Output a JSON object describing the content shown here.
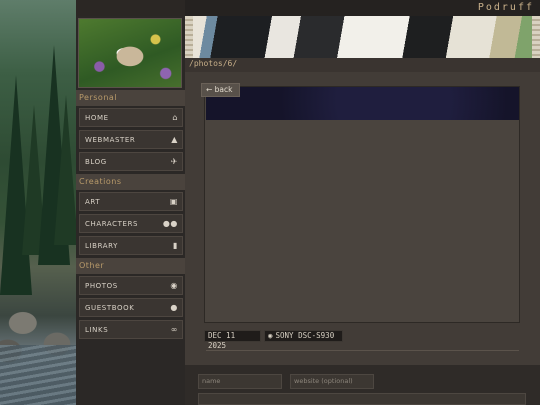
{
  "site": {
    "title": "Podruff"
  },
  "breadcrumb": {
    "path": "/photos/6/"
  },
  "sidebar": {
    "sections": [
      {
        "label": "Personal",
        "items": [
          {
            "label": "HOME",
            "icon": "home-icon"
          },
          {
            "label": "WEBMASTER",
            "icon": "bell-icon"
          },
          {
            "label": "BLOG",
            "icon": "plane-icon"
          }
        ]
      },
      {
        "label": "Creations",
        "items": [
          {
            "label": "ART",
            "icon": "image-icon"
          },
          {
            "label": "CHARACTERS",
            "icon": "users-icon"
          },
          {
            "label": "LIBRARY",
            "icon": "book-icon"
          }
        ]
      },
      {
        "label": "Other",
        "items": [
          {
            "label": "PHOTOS",
            "icon": "camera-icon"
          },
          {
            "label": "GUESTBOOK",
            "icon": "chat-icon"
          },
          {
            "label": "LINKS",
            "icon": "paperclip-icon"
          }
        ]
      }
    ]
  },
  "photo": {
    "back_label": "← back",
    "date": "DEC 11 2025",
    "camera": "SONY DSC-S930"
  },
  "comment_form": {
    "name_placeholder": "name",
    "website_placeholder": "website (optional)"
  }
}
